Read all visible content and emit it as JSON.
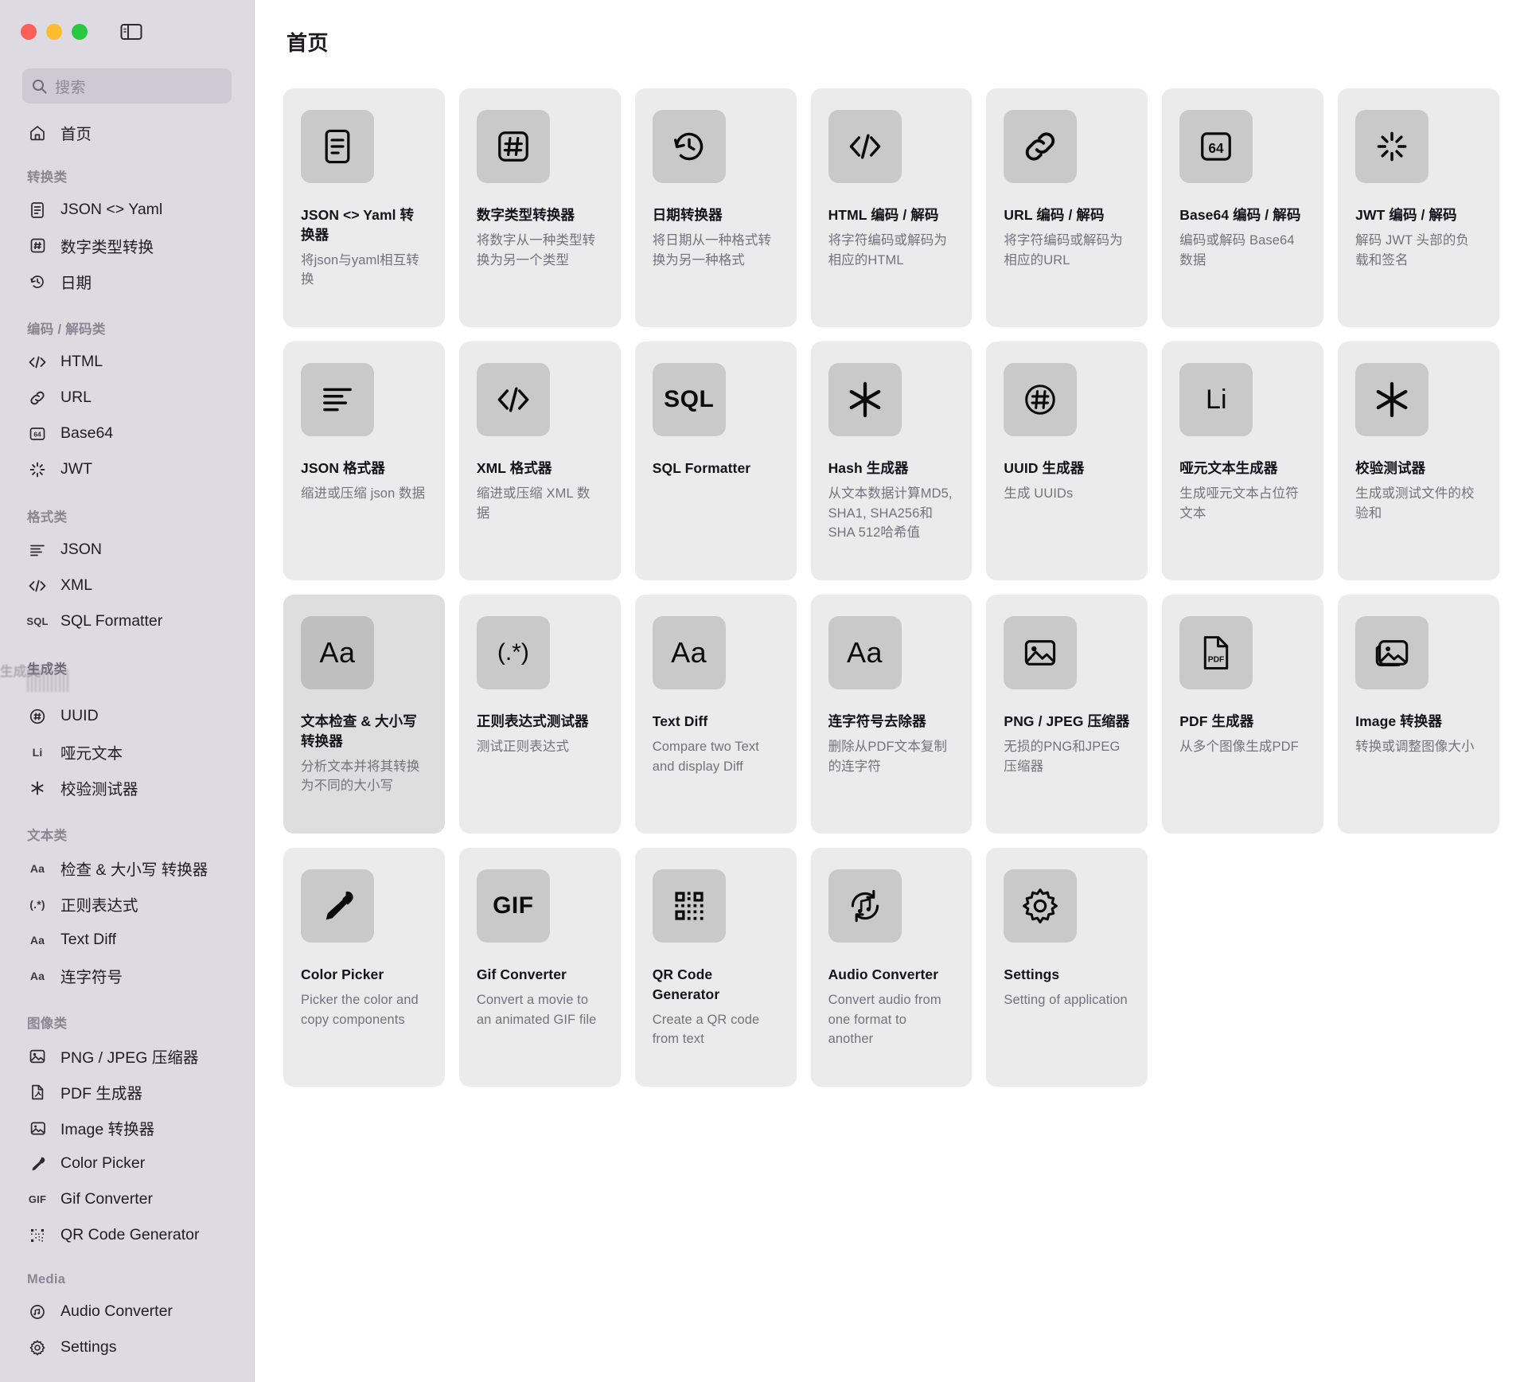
{
  "window": {
    "traffic_lights": [
      "close",
      "minimize",
      "zoom"
    ],
    "sidebar_toggle_icon": "sidebar-toggle-icon"
  },
  "sidebar": {
    "search": {
      "placeholder": "搜索",
      "value": "",
      "icon": "search-icon"
    },
    "home": {
      "label": "首页",
      "icon": "home-icon"
    },
    "groups": [
      {
        "label": "转换类",
        "items": [
          {
            "label": "JSON <> Yaml",
            "icon": "document-lines-icon"
          },
          {
            "label": "数字类型转换",
            "icon": "hash-box-icon"
          },
          {
            "label": "日期",
            "icon": "clock-rotate-icon"
          }
        ]
      },
      {
        "label": "编码 / 解码类",
        "items": [
          {
            "label": "HTML",
            "icon": "code-brackets-icon"
          },
          {
            "label": "URL",
            "icon": "link-icon"
          },
          {
            "label": "Base64",
            "icon": "base64-box-icon",
            "icon_text": "64"
          },
          {
            "label": "JWT",
            "icon": "spinner-icon"
          }
        ]
      },
      {
        "label": "格式类",
        "items": [
          {
            "label": "JSON",
            "icon": "align-left-icon"
          },
          {
            "label": "XML",
            "icon": "code-brackets-icon"
          },
          {
            "label": "SQL Formatter",
            "icon": "sql-icon",
            "icon_text": "SQL"
          }
        ]
      },
      {
        "label": "生成类",
        "glitched": true,
        "items": [
          {
            "label": "UUID",
            "icon": "hash-circle-icon"
          },
          {
            "label": "哑元文本",
            "icon": "li-icon",
            "icon_text": "Li"
          },
          {
            "label": "校验测试器",
            "icon": "asterisk-icon"
          }
        ]
      },
      {
        "label": "文本类",
        "items": [
          {
            "label": "检查 & 大小写 转换器",
            "icon": "aa-icon",
            "icon_text": "Aa"
          },
          {
            "label": "正则表达式",
            "icon": "regex-icon",
            "icon_text": "(.*)"
          },
          {
            "label": "Text Diff",
            "icon": "aa-icon",
            "icon_text": "Aa"
          },
          {
            "label": "连字符号",
            "icon": "aa-icon",
            "icon_text": "Aa"
          }
        ]
      },
      {
        "label": "图像类",
        "items": [
          {
            "label": "PNG / JPEG 压缩器",
            "icon": "image-icon"
          },
          {
            "label": "PDF 生成器",
            "icon": "pdf-file-icon"
          },
          {
            "label": "Image 转换器",
            "icon": "images-stack-icon"
          },
          {
            "label": "Color Picker",
            "icon": "eyedropper-icon"
          },
          {
            "label": "Gif Converter",
            "icon": "gif-icon",
            "icon_text": "GIF"
          },
          {
            "label": "QR Code Generator",
            "icon": "qr-code-icon"
          }
        ]
      },
      {
        "label": "Media",
        "items": [
          {
            "label": "Audio Converter",
            "icon": "audio-rotate-icon"
          },
          {
            "label": "Settings",
            "icon": "gear-icon"
          }
        ]
      }
    ]
  },
  "main": {
    "title": "首页",
    "cards": [
      {
        "title": "JSON <> Yaml 转换器",
        "desc": "将json与yaml相互转换",
        "icon": "document-lines-icon",
        "hover": false
      },
      {
        "title": "数字类型转换器",
        "desc": "将数字从一种类型转换为另一个类型",
        "icon": "hash-box-icon",
        "hover": false
      },
      {
        "title": "日期转换器",
        "desc": "将日期从一种格式转换为另一种格式",
        "icon": "clock-rotate-icon",
        "hover": false
      },
      {
        "title": "HTML 编码 / 解码",
        "desc": "将字符编码或解码为相应的HTML",
        "icon": "code-brackets-icon",
        "hover": false
      },
      {
        "title": "URL 编码 / 解码",
        "desc": "将字符编码或解码为相应的URL",
        "icon": "link-icon",
        "hover": false
      },
      {
        "title": "Base64 编码 / 解码",
        "desc": "编码或解码 Base64 数据",
        "icon": "base64-box-icon",
        "icon_text": "64",
        "hover": false
      },
      {
        "title": "JWT 编码 / 解码",
        "desc": "解码 JWT 头部的负载和签名",
        "icon": "spinner-icon",
        "hover": false
      },
      {
        "title": "JSON 格式器",
        "desc": "缩进或压缩 json 数据",
        "icon": "align-left-icon",
        "hover": false
      },
      {
        "title": "XML 格式器",
        "desc": "缩进或压缩 XML 数据",
        "icon": "code-brackets-icon",
        "hover": false
      },
      {
        "title": "SQL Formatter",
        "desc": "",
        "icon": "sql-icon",
        "icon_text": "SQL",
        "hover": false
      },
      {
        "title": "Hash 生成器",
        "desc": "从文本数据计算MD5, SHA1, SHA256和SHA 512哈希值",
        "icon": "asterisk-icon",
        "hover": false
      },
      {
        "title": "UUID 生成器",
        "desc": "生成 UUIDs",
        "icon": "hash-circle-icon",
        "hover": false
      },
      {
        "title": "哑元文本生成器",
        "desc": "生成哑元文本占位符文本",
        "icon": "li-icon",
        "icon_text": "Li",
        "hover": false
      },
      {
        "title": "校验测试器",
        "desc": "生成或测试文件的校验和",
        "icon": "asterisk-icon",
        "hover": false
      },
      {
        "title": "文本检查 & 大小写转换器",
        "desc": "分析文本并将其转换为不同的大小写",
        "icon": "aa-icon",
        "icon_text": "Aa",
        "hover": true
      },
      {
        "title": "正则表达式测试器",
        "desc": "测试正则表达式",
        "icon": "regex-icon",
        "icon_text": "(.*)",
        "hover": false
      },
      {
        "title": "Text Diff",
        "desc": "Compare two Text and display Diff",
        "icon": "aa-icon",
        "icon_text": "Aa",
        "hover": false
      },
      {
        "title": "连字符号去除器",
        "desc": "删除从PDF文本复制的连字符",
        "icon": "aa-icon",
        "icon_text": "Aa",
        "hover": false
      },
      {
        "title": "PNG / JPEG 压缩器",
        "desc": "无损的PNG和JPEG压缩器",
        "icon": "image-icon",
        "hover": false
      },
      {
        "title": "PDF 生成器",
        "desc": "从多个图像生成PDF",
        "icon": "pdf-file-icon",
        "hover": false
      },
      {
        "title": "Image 转换器",
        "desc": "转换或调整图像大小",
        "icon": "images-stack-icon",
        "hover": false
      },
      {
        "title": "Color Picker",
        "desc": "Picker the color and copy components",
        "icon": "eyedropper-icon",
        "hover": false
      },
      {
        "title": "Gif Converter",
        "desc": "Convert a movie to an animated GIF file",
        "icon": "gif-icon",
        "icon_text": "GIF",
        "hover": false
      },
      {
        "title": "QR Code Generator",
        "desc": "Create a QR code from text",
        "icon": "qr-code-icon",
        "hover": false
      },
      {
        "title": "Audio Converter",
        "desc": "Convert audio from one format to another",
        "icon": "audio-rotate-icon",
        "hover": false
      },
      {
        "title": "Settings",
        "desc": "Setting of application",
        "icon": "gear-icon",
        "hover": false
      }
    ]
  },
  "colors": {
    "sidebar_bg": "#dedae2",
    "card_bg": "#ebebeb",
    "card_hover_bg": "#dedede",
    "tile_bg": "#c9c9c9",
    "search_bg": "#cfc9d6",
    "traffic_red": "#ff5f57",
    "traffic_yellow": "#febc2e",
    "traffic_green": "#28c840"
  }
}
